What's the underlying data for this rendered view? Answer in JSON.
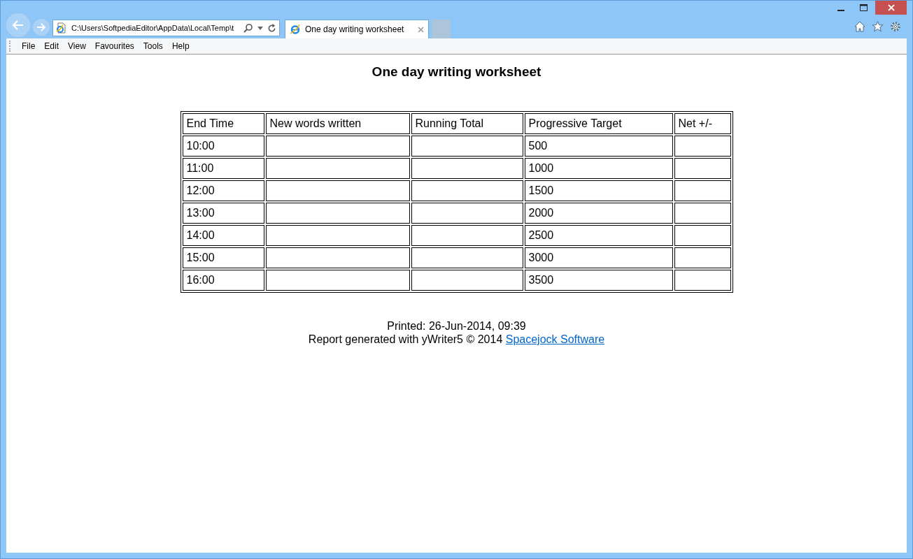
{
  "address_bar": {
    "value": "C:\\Users\\SoftpediaEditor\\AppData\\Local\\Temp\\t"
  },
  "tabs": [
    {
      "label": "One day writing worksheet",
      "selected": true
    }
  ],
  "menu": [
    "File",
    "Edit",
    "View",
    "Favourites",
    "Tools",
    "Help"
  ],
  "page": {
    "title": "One day writing worksheet",
    "table": {
      "columns": [
        "End Time",
        "New words written",
        "Running Total",
        "Progressive Target",
        "Net +/-"
      ],
      "rows": [
        [
          "10:00",
          "",
          "",
          "500",
          ""
        ],
        [
          "11:00",
          "",
          "",
          "1000",
          ""
        ],
        [
          "12:00",
          "",
          "",
          "1500",
          ""
        ],
        [
          "13:00",
          "",
          "",
          "2000",
          ""
        ],
        [
          "14:00",
          "",
          "",
          "2500",
          ""
        ],
        [
          "15:00",
          "",
          "",
          "3000",
          ""
        ],
        [
          "16:00",
          "",
          "",
          "3500",
          ""
        ]
      ]
    },
    "printed": "Printed: 26-Jun-2014, 09:39",
    "credit": "Report generated with yWriter5 © 2014",
    "link": "Spacejock Software"
  }
}
